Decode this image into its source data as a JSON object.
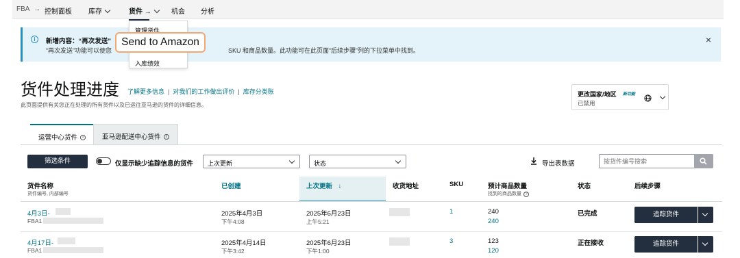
{
  "nav": {
    "fba": "FBA",
    "sep": "→",
    "dashboard": "控制面板",
    "inventory": "库存",
    "shipments": "货件",
    "shipments_arrow": "→",
    "opportunities": "机会",
    "analytics": "分析"
  },
  "dropdown": {
    "item1": "管理货件",
    "item3": "入库绩效",
    "tooltip": "Send to Amazon"
  },
  "banner": {
    "title": "新增内容：“再次发送”",
    "text_left": "“再次发送”功能可以使您",
    "text_right": "SKU 和商品数量。此功能可在此页面“后续步骤”列的下拉菜单中找到。",
    "close": "×"
  },
  "page": {
    "title": "货件处理进度",
    "link1": "了解更多信息",
    "link2": "对我们的工作做出评价",
    "link3": "库存分类账",
    "sep": "|",
    "desc": "此页面提供有关您正在处理的所有货件以及已运往亚马逊的货件的详细信息。"
  },
  "country": {
    "label": "更改国家/地区",
    "badge": "新功能",
    "status": "已禁用"
  },
  "tabs": {
    "active": "运营中心货件",
    "inactive": "亚马逊配送中心货件",
    "info": "i"
  },
  "filters": {
    "filter_button": "筛选条件",
    "toggle_label": "仅显示缺少追踪信息的货件",
    "sort_select": "上次更新",
    "status_select": "状态",
    "export": "导出表数据",
    "search_placeholder": "按货件编号搜索"
  },
  "table": {
    "headers": {
      "name": "货件名称",
      "name_sub": "货件编号, 内部编号",
      "created": "已创建",
      "updated": "上次更新",
      "updated_arrow": "↓",
      "address": "收货地址",
      "sku": "SKU",
      "qty": "预计商品数量",
      "qty_sub": "找到的商品数量",
      "status": "状态",
      "next": "后续步骤"
    },
    "rows": [
      {
        "name": "4月3日-",
        "id": "FBA1",
        "created_date": "2025年4月3日",
        "created_time": "下午4:08",
        "updated_date": "2025年6月23日",
        "updated_time": "上午5:21",
        "sku": "1",
        "qty_expected": "240",
        "qty_found": "240",
        "status": "已完成",
        "action": "追踪货件"
      },
      {
        "name": "4月17日-",
        "id": "FBA1",
        "created_date": "2025年4月14日",
        "created_time": "下午3:42",
        "updated_date": "2025年6月23日",
        "updated_time": "下午1:00",
        "sku": "3",
        "qty_expected": "123",
        "qty_found": "120",
        "status": "正在接收",
        "action": "追踪货件"
      }
    ]
  },
  "colors": {
    "dark_button": "#232f3e",
    "link": "#007185",
    "banner_bg": "#e4f3fa",
    "tooltip_border": "#f3a772"
  }
}
